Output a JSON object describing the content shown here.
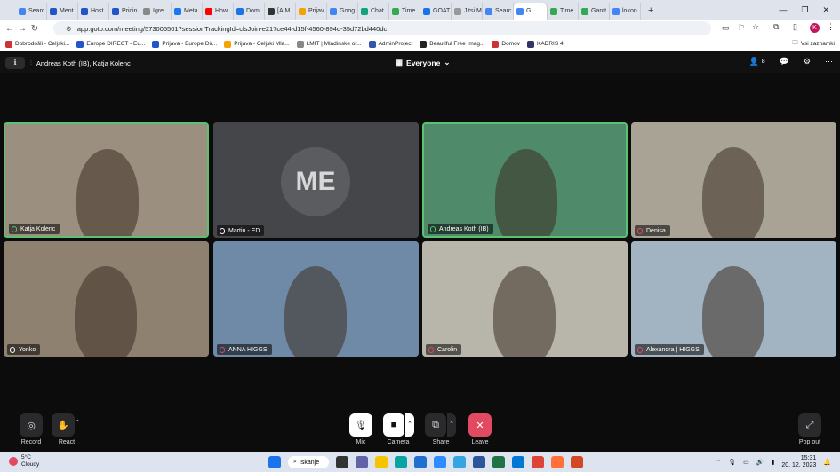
{
  "browser": {
    "tabs": [
      {
        "label": "Searc",
        "color": "#4285f4"
      },
      {
        "label": "Ment",
        "color": "#2255cc"
      },
      {
        "label": "Host",
        "color": "#2255cc"
      },
      {
        "label": "Pricin",
        "color": "#2255cc"
      },
      {
        "label": "Igre",
        "color": "#888888"
      },
      {
        "label": "Meta",
        "color": "#1877f2"
      },
      {
        "label": "How",
        "color": "#ff0000"
      },
      {
        "label": "Dom",
        "color": "#1a73e8"
      },
      {
        "label": "[A.M",
        "color": "#333333"
      },
      {
        "label": "Prijav",
        "color": "#f4a300"
      },
      {
        "label": "Goog",
        "color": "#4285f4"
      },
      {
        "label": "Chat",
        "color": "#10a37f"
      },
      {
        "label": "Time",
        "color": "#34a853"
      },
      {
        "label": "GOAT",
        "color": "#1a73e8"
      },
      {
        "label": "Jitsi M",
        "color": "#999999"
      },
      {
        "label": "Searc",
        "color": "#4285f4"
      },
      {
        "label": "G",
        "color": "#4285f4"
      },
      {
        "label": "Time",
        "color": "#34a853"
      },
      {
        "label": "Gantt",
        "color": "#34a853"
      },
      {
        "label": "lokon",
        "color": "#4285f4"
      }
    ],
    "url": "app.goto.com/meeting/573005501?sessionTrackingId=clsJoin-e217ce44-d15f-4560-894d-35d72bd440dc",
    "profile_initial": "K",
    "bookmarks": [
      {
        "label": "Dobrodošli - Celjski...",
        "color": "#cc3333"
      },
      {
        "label": "Europe DIRECT - Eu...",
        "color": "#2255cc"
      },
      {
        "label": "Prijava - Europe Dir...",
        "color": "#2255cc"
      },
      {
        "label": "Prijava - Celjski Mla...",
        "color": "#f4a300"
      },
      {
        "label": "LMIT | Mladinske or...",
        "color": "#888888"
      },
      {
        "label": "AdminProject",
        "color": "#3355aa"
      },
      {
        "label": "Beautiful Free Imag...",
        "color": "#222222"
      },
      {
        "label": "Domov",
        "color": "#cc3333"
      },
      {
        "label": "KADRIS 4",
        "color": "#333366"
      }
    ],
    "all_bookmarks": "Vsi zaznamki"
  },
  "meeting": {
    "speaking": "Andreas Koth (IB), Katja Kolenc",
    "view_label": "Everyone",
    "participant_count": "8",
    "tiles": [
      {
        "name": "Katja Kolenc",
        "mic": "live",
        "speaking": true,
        "bg": "#9b8f7f"
      },
      {
        "name": "Martin - ED",
        "mic": "muted",
        "speaking": false,
        "bg": "#45464a",
        "avatar": "ME"
      },
      {
        "name": "Andreas Koth (IB)",
        "mic": "live",
        "speaking": true,
        "bg": "#4f8a6a"
      },
      {
        "name": "Denisa",
        "mic": "off",
        "speaking": false,
        "bg": "#a9a396"
      },
      {
        "name": "Yonko",
        "mic": "muted",
        "speaking": false,
        "bg": "#8e8170"
      },
      {
        "name": "ANNA HIGGS",
        "mic": "off",
        "speaking": false,
        "bg": "#6f8aa6"
      },
      {
        "name": "Carolin",
        "mic": "off",
        "speaking": false,
        "bg": "#b8b5aa"
      },
      {
        "name": "Alexandra | HIGGS",
        "mic": "off",
        "speaking": false,
        "bg": "#a2b3c2"
      }
    ]
  },
  "controls": {
    "record": "Record",
    "react": "React",
    "mic": "Mic",
    "camera": "Camera",
    "share": "Share",
    "leave": "Leave",
    "popout": "Pop out"
  },
  "taskbar": {
    "weather_temp": "5°C",
    "weather_text": "Cloudy",
    "search": "Iskanje",
    "time": "15:31",
    "date": "20. 12. 2023"
  }
}
